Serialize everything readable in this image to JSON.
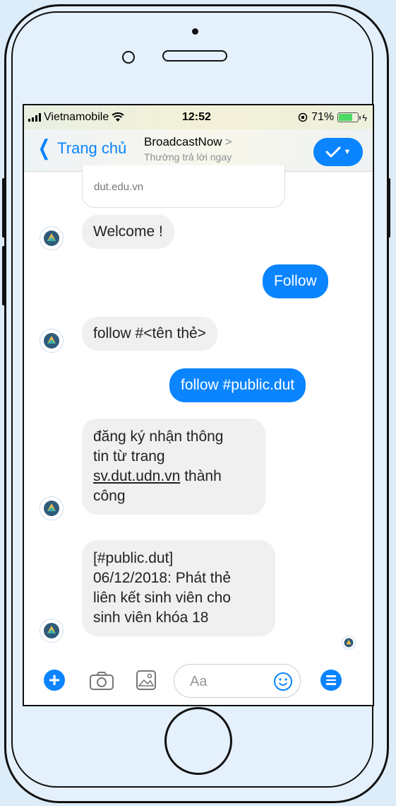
{
  "status_bar": {
    "carrier": "Vietnamobile",
    "time": "12:52",
    "battery": "71%",
    "battery_level": 0.71
  },
  "nav": {
    "back_label": "Trang chủ",
    "title": "BroadcastNow",
    "title_chevron": ">",
    "subtitle": "Thường trả lời ngay",
    "action_icon": "check-icon"
  },
  "messages": [
    {
      "type": "card-tail",
      "text": "dut.edu.vn"
    },
    {
      "type": "incoming",
      "text": "Welcome !"
    },
    {
      "type": "outgoing",
      "text": "Follow"
    },
    {
      "type": "incoming",
      "text": "follow #<tên thẻ>"
    },
    {
      "type": "outgoing",
      "text": "follow #public.dut"
    },
    {
      "type": "incoming",
      "lines": [
        "đăng ký nhận thông",
        "tin từ trang",
        "sv.dut.udn.vn",
        " thành",
        "công"
      ]
    },
    {
      "type": "incoming",
      "lines": [
        "[#public.dut]",
        "06/12/2018: Phát thẻ",
        "liên kết sinh viên cho",
        "sinh viên khóa 18"
      ]
    }
  ],
  "composer": {
    "placeholder": "Aa",
    "icons": [
      "plus-icon",
      "camera-icon",
      "gallery-icon",
      "emoji-icon",
      "menu-icon"
    ]
  },
  "colors": {
    "accent": "#0a84ff",
    "incoming_bubble": "#f0f0f0",
    "background": "#dcecf9"
  }
}
